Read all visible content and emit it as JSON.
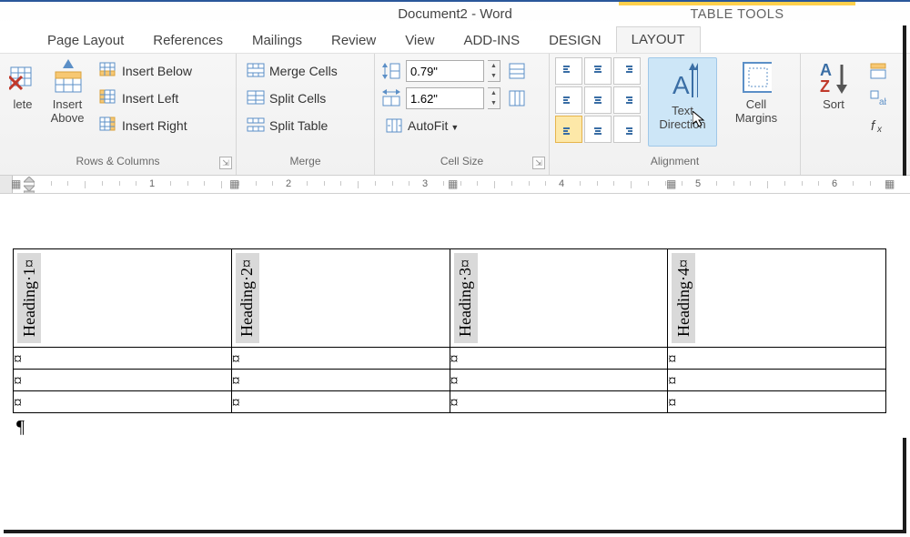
{
  "title": "Document2 - Word",
  "contextual_tab_group": "TABLE TOOLS",
  "tabs": {
    "page_layout": "Page Layout",
    "references": "References",
    "mailings": "Mailings",
    "review": "Review",
    "view": "View",
    "addins": "ADD-INS",
    "design": "DESIGN",
    "layout": "LAYOUT"
  },
  "groups": {
    "rows_cols": {
      "label": "Rows & Columns",
      "delete": "lete",
      "insert_above": "Insert Above",
      "insert_below": "Insert Below",
      "insert_left": "Insert Left",
      "insert_right": "Insert Right"
    },
    "merge": {
      "label": "Merge",
      "merge_cells": "Merge Cells",
      "split_cells": "Split Cells",
      "split_table": "Split Table"
    },
    "cell_size": {
      "label": "Cell Size",
      "height": "0.79\"",
      "width": "1.62\"",
      "autofit": "AutoFit"
    },
    "alignment": {
      "label": "Alignment",
      "text_direction": "Text Direction",
      "cell_margins": "Cell Margins"
    },
    "data": {
      "sort": "Sort"
    }
  },
  "ruler": {
    "marks": [
      1,
      2,
      3,
      4,
      5,
      6
    ]
  },
  "table": {
    "headings": [
      "Heading·1¤",
      "Heading·2¤",
      "Heading·3¤",
      "Heading·4¤"
    ],
    "cell_mark": "¤",
    "body_rows": 3
  },
  "paragraph_mark": "¶"
}
